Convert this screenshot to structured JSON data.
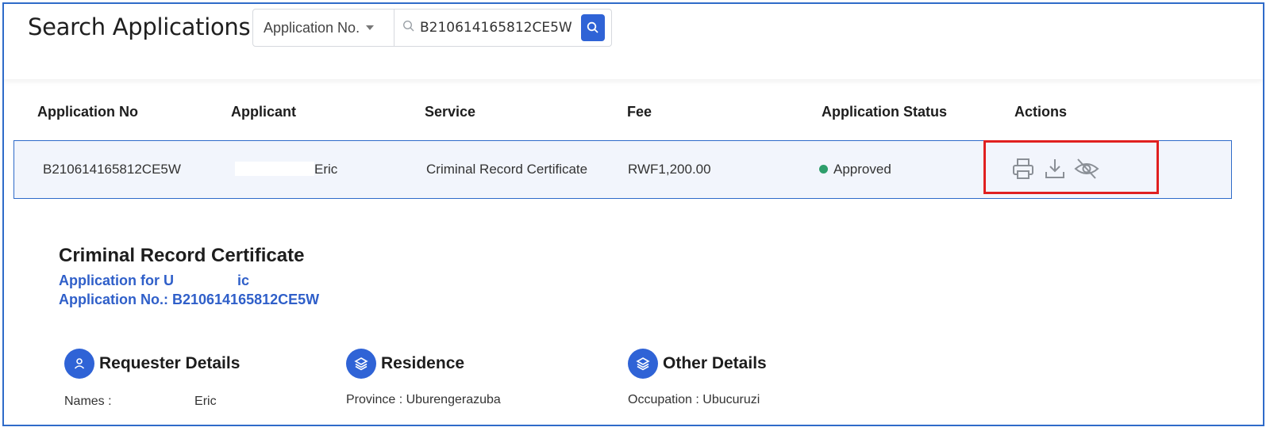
{
  "header": {
    "title": "Search Applications",
    "search_type": "Application No.",
    "search_value": "B210614165812CE5W"
  },
  "table": {
    "columns": [
      "Application No",
      "Applicant",
      "Service",
      "Fee",
      "Application Status",
      "Actions"
    ],
    "row": {
      "application_no": "B210614165812CE5W",
      "applicant": "Eric",
      "service": "Criminal Record Certificate",
      "fee": "RWF1,200.00",
      "status": "Approved",
      "status_color": "#2e9e6b",
      "actions": [
        "printer-icon",
        "download-icon",
        "eye-off-icon"
      ]
    }
  },
  "details": {
    "title": "Criminal Record Certificate",
    "application_for_prefix": "Application for U",
    "application_for_suffix": "ic",
    "application_no_line": "Application No.: B210614165812CE5W",
    "sections": {
      "requester": {
        "title": "Requester Details",
        "field_label": "Names :",
        "field_value": "Eric"
      },
      "residence": {
        "title": "Residence",
        "field_label": "Province :",
        "field_value": "Uburengerazuba"
      },
      "other": {
        "title": "Other Details",
        "field_label": "Occupation :",
        "field_value": "Ubucuruzi"
      }
    }
  },
  "colors": {
    "accent": "#2f63d6",
    "highlight_box": "#e02020",
    "row_bg": "#f2f5fc"
  }
}
